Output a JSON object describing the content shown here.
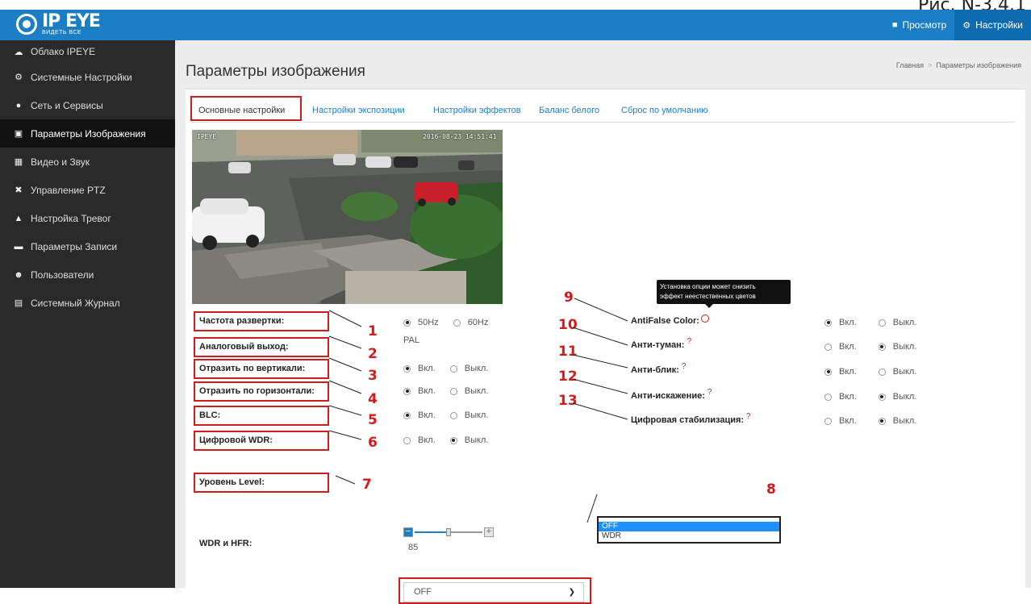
{
  "figure_caption": "Рис. N-3.4.1",
  "logo": {
    "name": "IP EYE",
    "tagline": "ВИДЕТЬ ВСЕ"
  },
  "topnav": [
    {
      "label": "Просмотр",
      "icon": "video-camera-icon"
    },
    {
      "label": "Настройки",
      "icon": "gears-icon"
    }
  ],
  "sidebar": {
    "items": [
      {
        "label": "Облако IPEYE",
        "icon": "cloud-icon"
      },
      {
        "label": "Системные Настройки",
        "icon": "gears-icon"
      },
      {
        "label": "Сеть и Сервисы",
        "icon": "globe-icon"
      },
      {
        "label": "Параметры Изображения",
        "icon": "image-icon",
        "active": true
      },
      {
        "label": "Видео и Звук",
        "icon": "video-file-icon"
      },
      {
        "label": "Управление PTZ",
        "icon": "move-arrows-icon"
      },
      {
        "label": "Настройка Тревог",
        "icon": "warning-icon"
      },
      {
        "label": "Параметры Записи",
        "icon": "hdd-icon"
      },
      {
        "label": "Пользователи",
        "icon": "users-icon"
      },
      {
        "label": "Системный Журнал",
        "icon": "log-file-icon"
      }
    ]
  },
  "page": {
    "title": "Параметры изображения",
    "breadcrumb": {
      "home": "Главная",
      "current": "Параметры изображения"
    }
  },
  "tabs": [
    {
      "label": "Основные настройки",
      "active": true
    },
    {
      "label": "Настройки экспозиции"
    },
    {
      "label": "Настройки эффектов"
    },
    {
      "label": "Баланс белого"
    },
    {
      "label": "Сброс по умолчанию"
    }
  ],
  "preview": {
    "osd_name": "IPEYE",
    "osd_time": "2016-08-23 14:51:41"
  },
  "radio_labels": {
    "on": "Вкл.",
    "off": "Выкл."
  },
  "left_settings": {
    "scan_rate": {
      "label": "Частота развертки:",
      "number": "1",
      "options": [
        "50Hz",
        "60Hz"
      ],
      "selected": 0
    },
    "analog_out": {
      "label": "Аналоговый выход:",
      "number": "2",
      "value": "PAL"
    },
    "flip_vertical": {
      "label": "Отразить по вертикали:",
      "number": "3",
      "selected": "on"
    },
    "flip_horizontal": {
      "label": "Отразить по горизонтали:",
      "number": "4",
      "selected": "on"
    },
    "blc": {
      "label": "BLC:",
      "number": "5",
      "selected": "on"
    },
    "digital_wdr": {
      "label": "Цифровой WDR:",
      "number": "6",
      "selected": "off"
    },
    "level": {
      "label": "Уровень Level:",
      "number": "7",
      "value": "85",
      "fraction": 0.5
    },
    "wdr_hfr": {
      "label": "WDR и HFR:",
      "value": "OFF",
      "number": "8",
      "options": [
        "OFF",
        "WDR"
      ]
    }
  },
  "right_settings": {
    "antifalse": {
      "label": "AntiFalse Color:",
      "number": "9",
      "selected": "on"
    },
    "antifog": {
      "label": "Анти-туман:",
      "number": "10",
      "selected": "off"
    },
    "antiglare": {
      "label": "Анти-блик:",
      "number": "11",
      "selected": "on"
    },
    "antidistortion": {
      "label": "Анти-искажение:",
      "number": "12",
      "selected": "off"
    },
    "digital_stab": {
      "label": "Цифровая стабилизация:",
      "number": "13",
      "selected": "off"
    }
  },
  "tooltip": {
    "line1": "Установка опции может снизить",
    "line2": "эффект неестественных цветов"
  },
  "help_mark": "?",
  "colors": {
    "topbar": "#1c7ec5",
    "sidebar": "#2a2a2a",
    "annotation": "#d01c1c",
    "link": "#1c7ec5"
  }
}
